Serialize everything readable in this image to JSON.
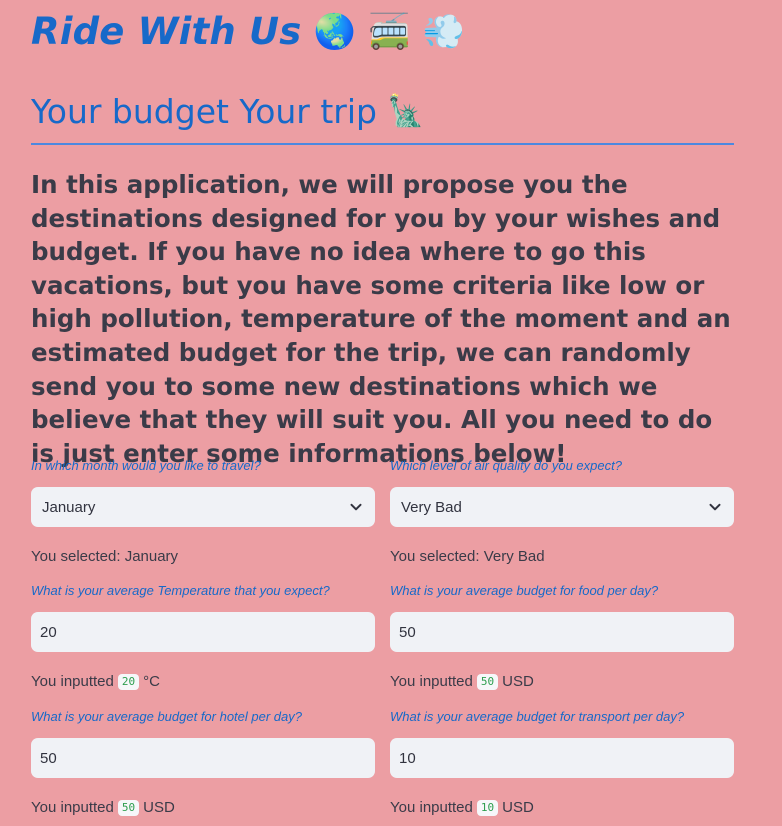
{
  "header": {
    "title": "Ride With Us",
    "emojis": [
      "🌏",
      "🚎",
      "💨"
    ]
  },
  "subheader": {
    "title": "Your budget Your trip",
    "emoji": "🗽"
  },
  "intro": "In this application, we will propose you the destinations designed for you by your wishes and budget. If you have no idea where to go this vacations, but you have some criteria like low or high pollution, temperature of the moment and an estimated budget for the trip, we can randomly send you to some new destinations which we believe that they will suit you. All you need to do is just enter some informations below!",
  "month": {
    "label": "In which month would you like to travel?",
    "value": "January",
    "note_prefix": "You selected: ",
    "note_value": "January"
  },
  "air_quality": {
    "label": "Which level of air quality do you expect?",
    "value": "Very Bad",
    "note_prefix": "You selected: ",
    "note_value": "Very Bad"
  },
  "temperature": {
    "label": "What is your average Temperature that you expect?",
    "value": "20",
    "note_prefix": "You inputted",
    "note_value": "20",
    "note_unit": "°C"
  },
  "food": {
    "label": "What is your average budget for food per day?",
    "value": "50",
    "note_prefix": "You inputted",
    "note_value": "50",
    "note_unit": "USD"
  },
  "hotel": {
    "label": "What is your average budget for hotel per day?",
    "value": "50",
    "note_prefix": "You inputted",
    "note_value": "50",
    "note_unit": "USD"
  },
  "transport": {
    "label": "What is your average budget for transport per day?",
    "value": "10",
    "note_prefix": "You inputted",
    "note_value": "10",
    "note_unit": "USD"
  },
  "colors": {
    "background": "#ec9ea3",
    "accent": "#1769c9",
    "input_bg": "#f0f2f6",
    "code_text": "#2e9e4f"
  }
}
